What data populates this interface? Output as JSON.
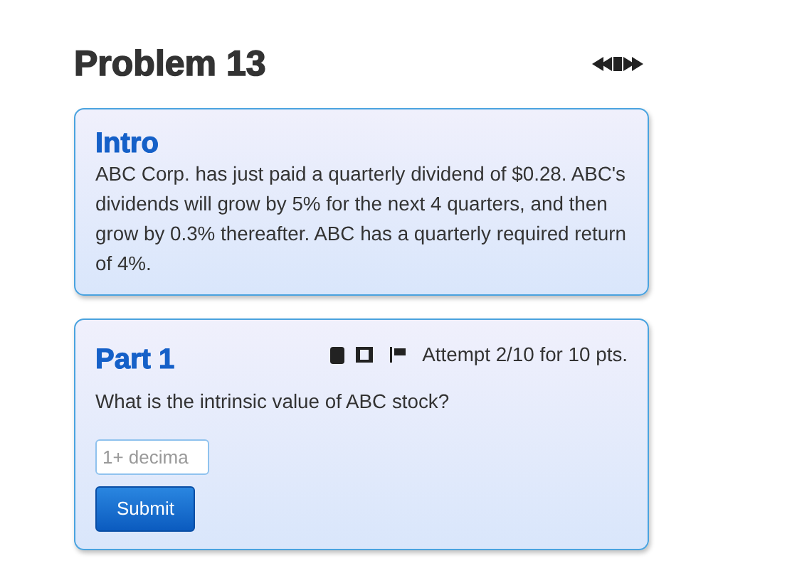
{
  "title": "Problem 13",
  "intro": {
    "heading": "Intro",
    "text": "ABC Corp. has just paid a quarterly dividend of $0.28. ABC's dividends will grow by 5% for the next 4 quarters, and then grow by 0.3% thereafter. ABC has a quarterly required return of 4%."
  },
  "part": {
    "heading": "Part 1",
    "attempt": "Attempt 2/10 for 10 pts.",
    "question": "What is the intrinsic value of ABC stock?",
    "answer": {
      "placeholder": "1+ decima"
    },
    "button": "Submit"
  }
}
